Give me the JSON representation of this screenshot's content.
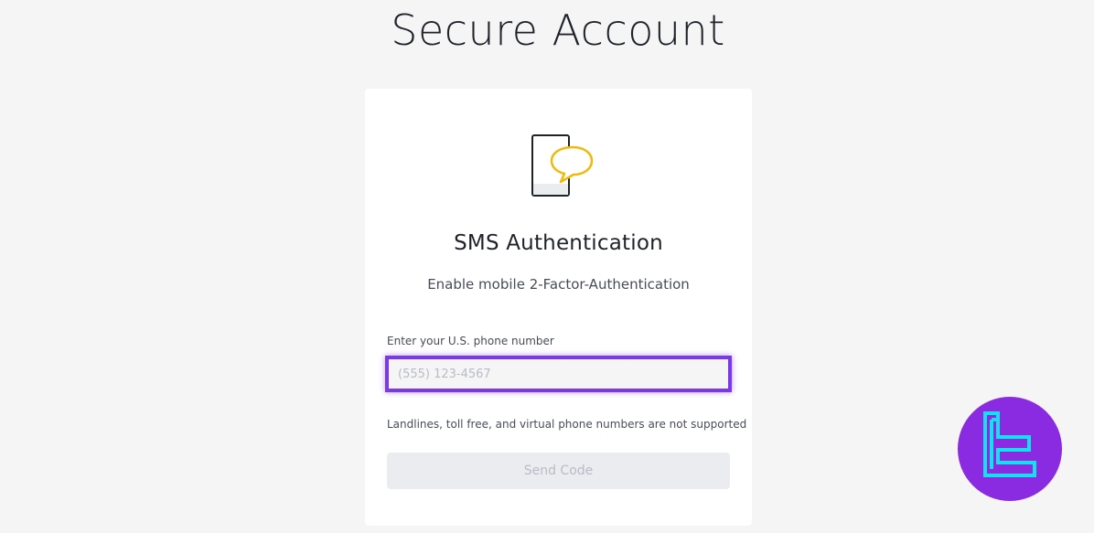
{
  "page": {
    "title": "Secure Account"
  },
  "card": {
    "icon": "phone-chat-icon",
    "title": "SMS Authentication",
    "subtitle": "Enable mobile 2-Factor-Authentication",
    "phone_field": {
      "label": "Enter your U.S. phone number",
      "value": "",
      "placeholder": "(555) 123-4567"
    },
    "hint": "Landlines, toll free, and virtual phone numbers are not supported",
    "send_button": {
      "label": "Send Code",
      "enabled": false
    }
  },
  "brand_logo": {
    "icon": "brand-logo-icon"
  },
  "colors": {
    "background": "#f5f5f5",
    "card": "#ffffff",
    "accent_yellow": "#f0b90b",
    "highlight_purple": "#7b38e8",
    "logo_purple": "#8a2be2",
    "logo_cyan": "#14e0ef",
    "button_disabled": "#eaecef"
  }
}
